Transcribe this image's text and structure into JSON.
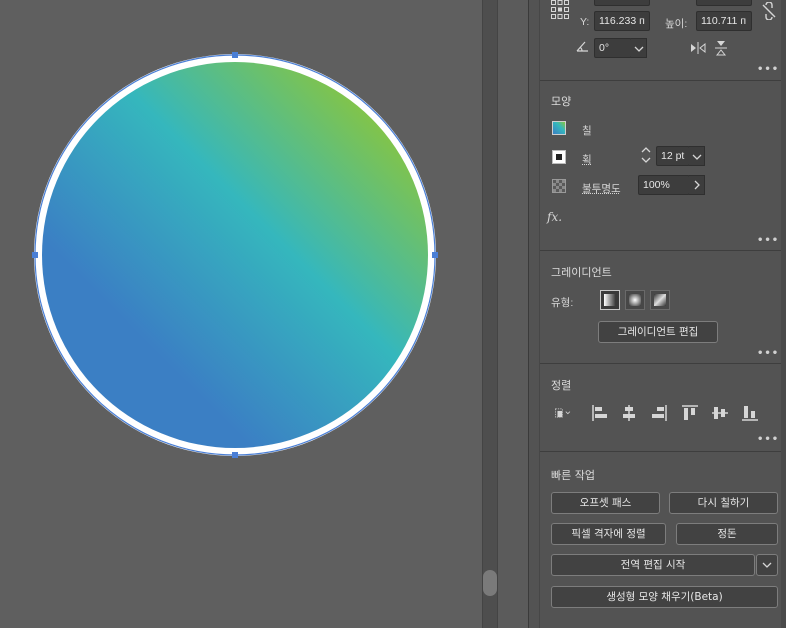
{
  "transform": {
    "y_label": "Y:",
    "y_value": "116.233 п",
    "height_label": "높이:",
    "height_value": "110.711 п",
    "angle_value": "0°"
  },
  "appearance": {
    "title": "모양",
    "fill_label": "칠",
    "stroke_label": "획",
    "stroke_weight": "12 pt",
    "opacity_label": "불투명도",
    "opacity_value": "100%",
    "fx_label": "fx."
  },
  "gradient": {
    "title": "그레이디언트",
    "type_label": "유형:",
    "edit_button": "그레이디언트 편집",
    "colors": [
      "#3b7fc4",
      "#35b7bd",
      "#88c540"
    ]
  },
  "align": {
    "title": "정렬"
  },
  "quick_actions": {
    "title": "빠른 작업",
    "offset_path": "오프셋 패스",
    "recolor": "다시 칠하기",
    "pixel_grid": "픽셀 격자에 정렬",
    "arrange": "정돈",
    "global_edit": "전역 편집 시작",
    "generative_fill": "생성형 모양 채우기(Beta)"
  },
  "more_label": "•••"
}
